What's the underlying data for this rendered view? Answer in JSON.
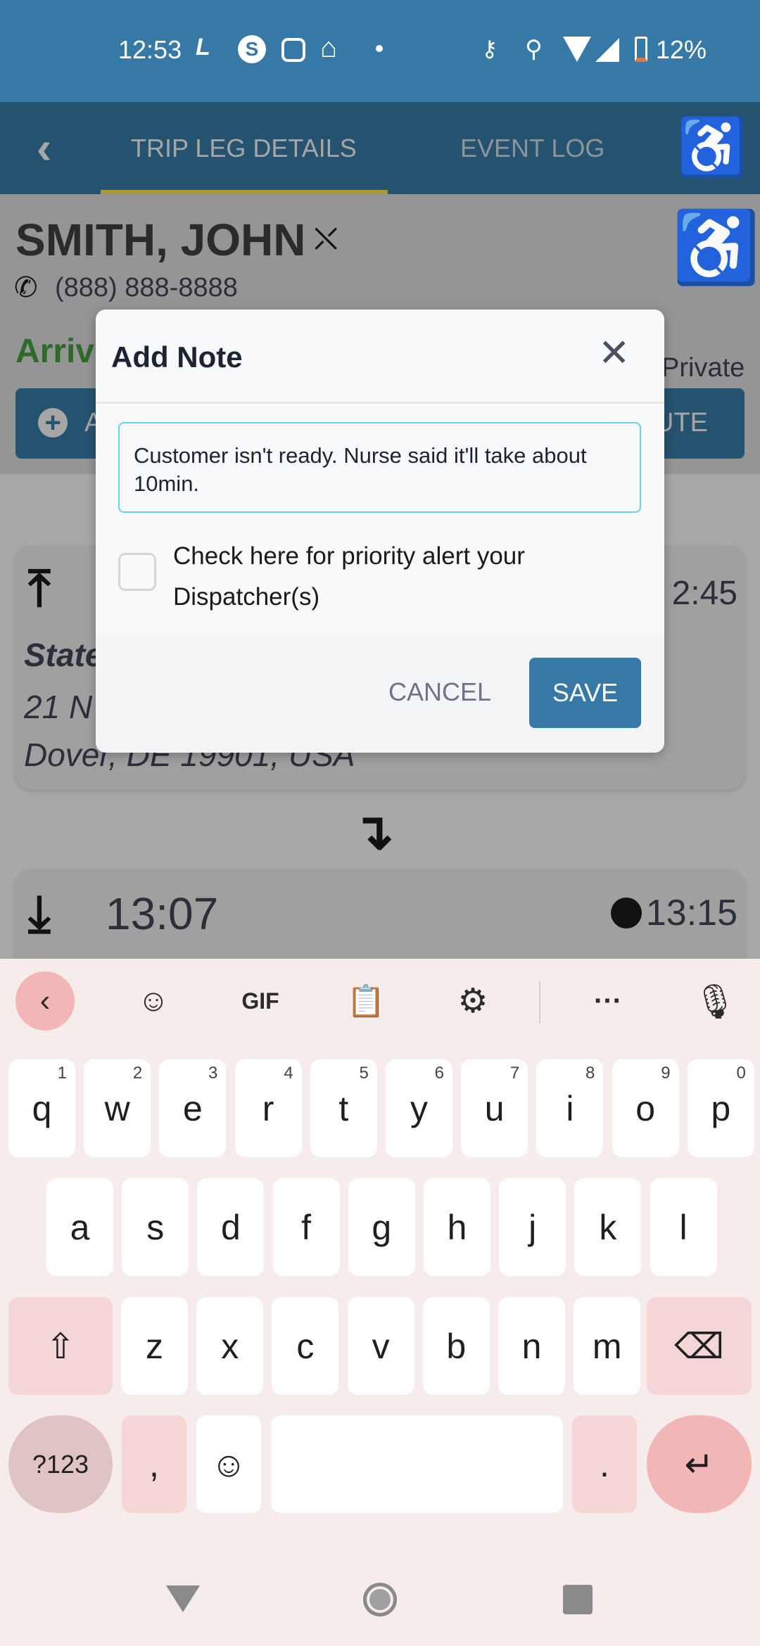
{
  "status_bar": {
    "time": "12:53",
    "battery": "12%",
    "left_icons": [
      "ab-route-icon",
      "skype-icon",
      "instagram-icon",
      "home-icon",
      "dot-icon"
    ],
    "right_icons": [
      "vpn-key-icon",
      "location-icon",
      "wifi-icon",
      "signal-icon",
      "battery-icon"
    ]
  },
  "app_bar": {
    "tabs": [
      {
        "label": "TRIP LEG DETAILS",
        "active": true
      },
      {
        "label": "EVENT LOG",
        "active": false
      }
    ],
    "accent": "#a99a3a"
  },
  "passenger": {
    "name": "SMITH, JOHN",
    "phone": "(888) 888-8888",
    "status": "Arriv",
    "payer": "Private",
    "left_button": "A",
    "right_button": "UTE"
  },
  "pickup": {
    "time": "2:45",
    "title": "State",
    "address_line1": "21 N",
    "address_line2": "Dover, DE 19901, USA"
  },
  "dropoff": {
    "time": "13:07",
    "eta": "13:15"
  },
  "modal": {
    "title": "Add Note",
    "note": "Customer isn't ready. Nurse said it'll take about 10min.",
    "checkbox_label": "Check here for priority alert your Dispatcher(s)",
    "checkbox_checked": false,
    "cancel": "CANCEL",
    "save": "SAVE",
    "save_color": "#3679a6"
  },
  "keyboard": {
    "toolbar": {
      "gif": "GIF"
    },
    "row1": [
      {
        "k": "q",
        "h": "1"
      },
      {
        "k": "w",
        "h": "2"
      },
      {
        "k": "e",
        "h": "3"
      },
      {
        "k": "r",
        "h": "4"
      },
      {
        "k": "t",
        "h": "5"
      },
      {
        "k": "y",
        "h": "6"
      },
      {
        "k": "u",
        "h": "7"
      },
      {
        "k": "i",
        "h": "8"
      },
      {
        "k": "o",
        "h": "9"
      },
      {
        "k": "p",
        "h": "0"
      }
    ],
    "row2": [
      "a",
      "s",
      "d",
      "f",
      "g",
      "h",
      "j",
      "k",
      "l"
    ],
    "row3": [
      "z",
      "x",
      "c",
      "v",
      "b",
      "n",
      "m"
    ],
    "symbols": "?123",
    "comma": ",",
    "period": "."
  }
}
